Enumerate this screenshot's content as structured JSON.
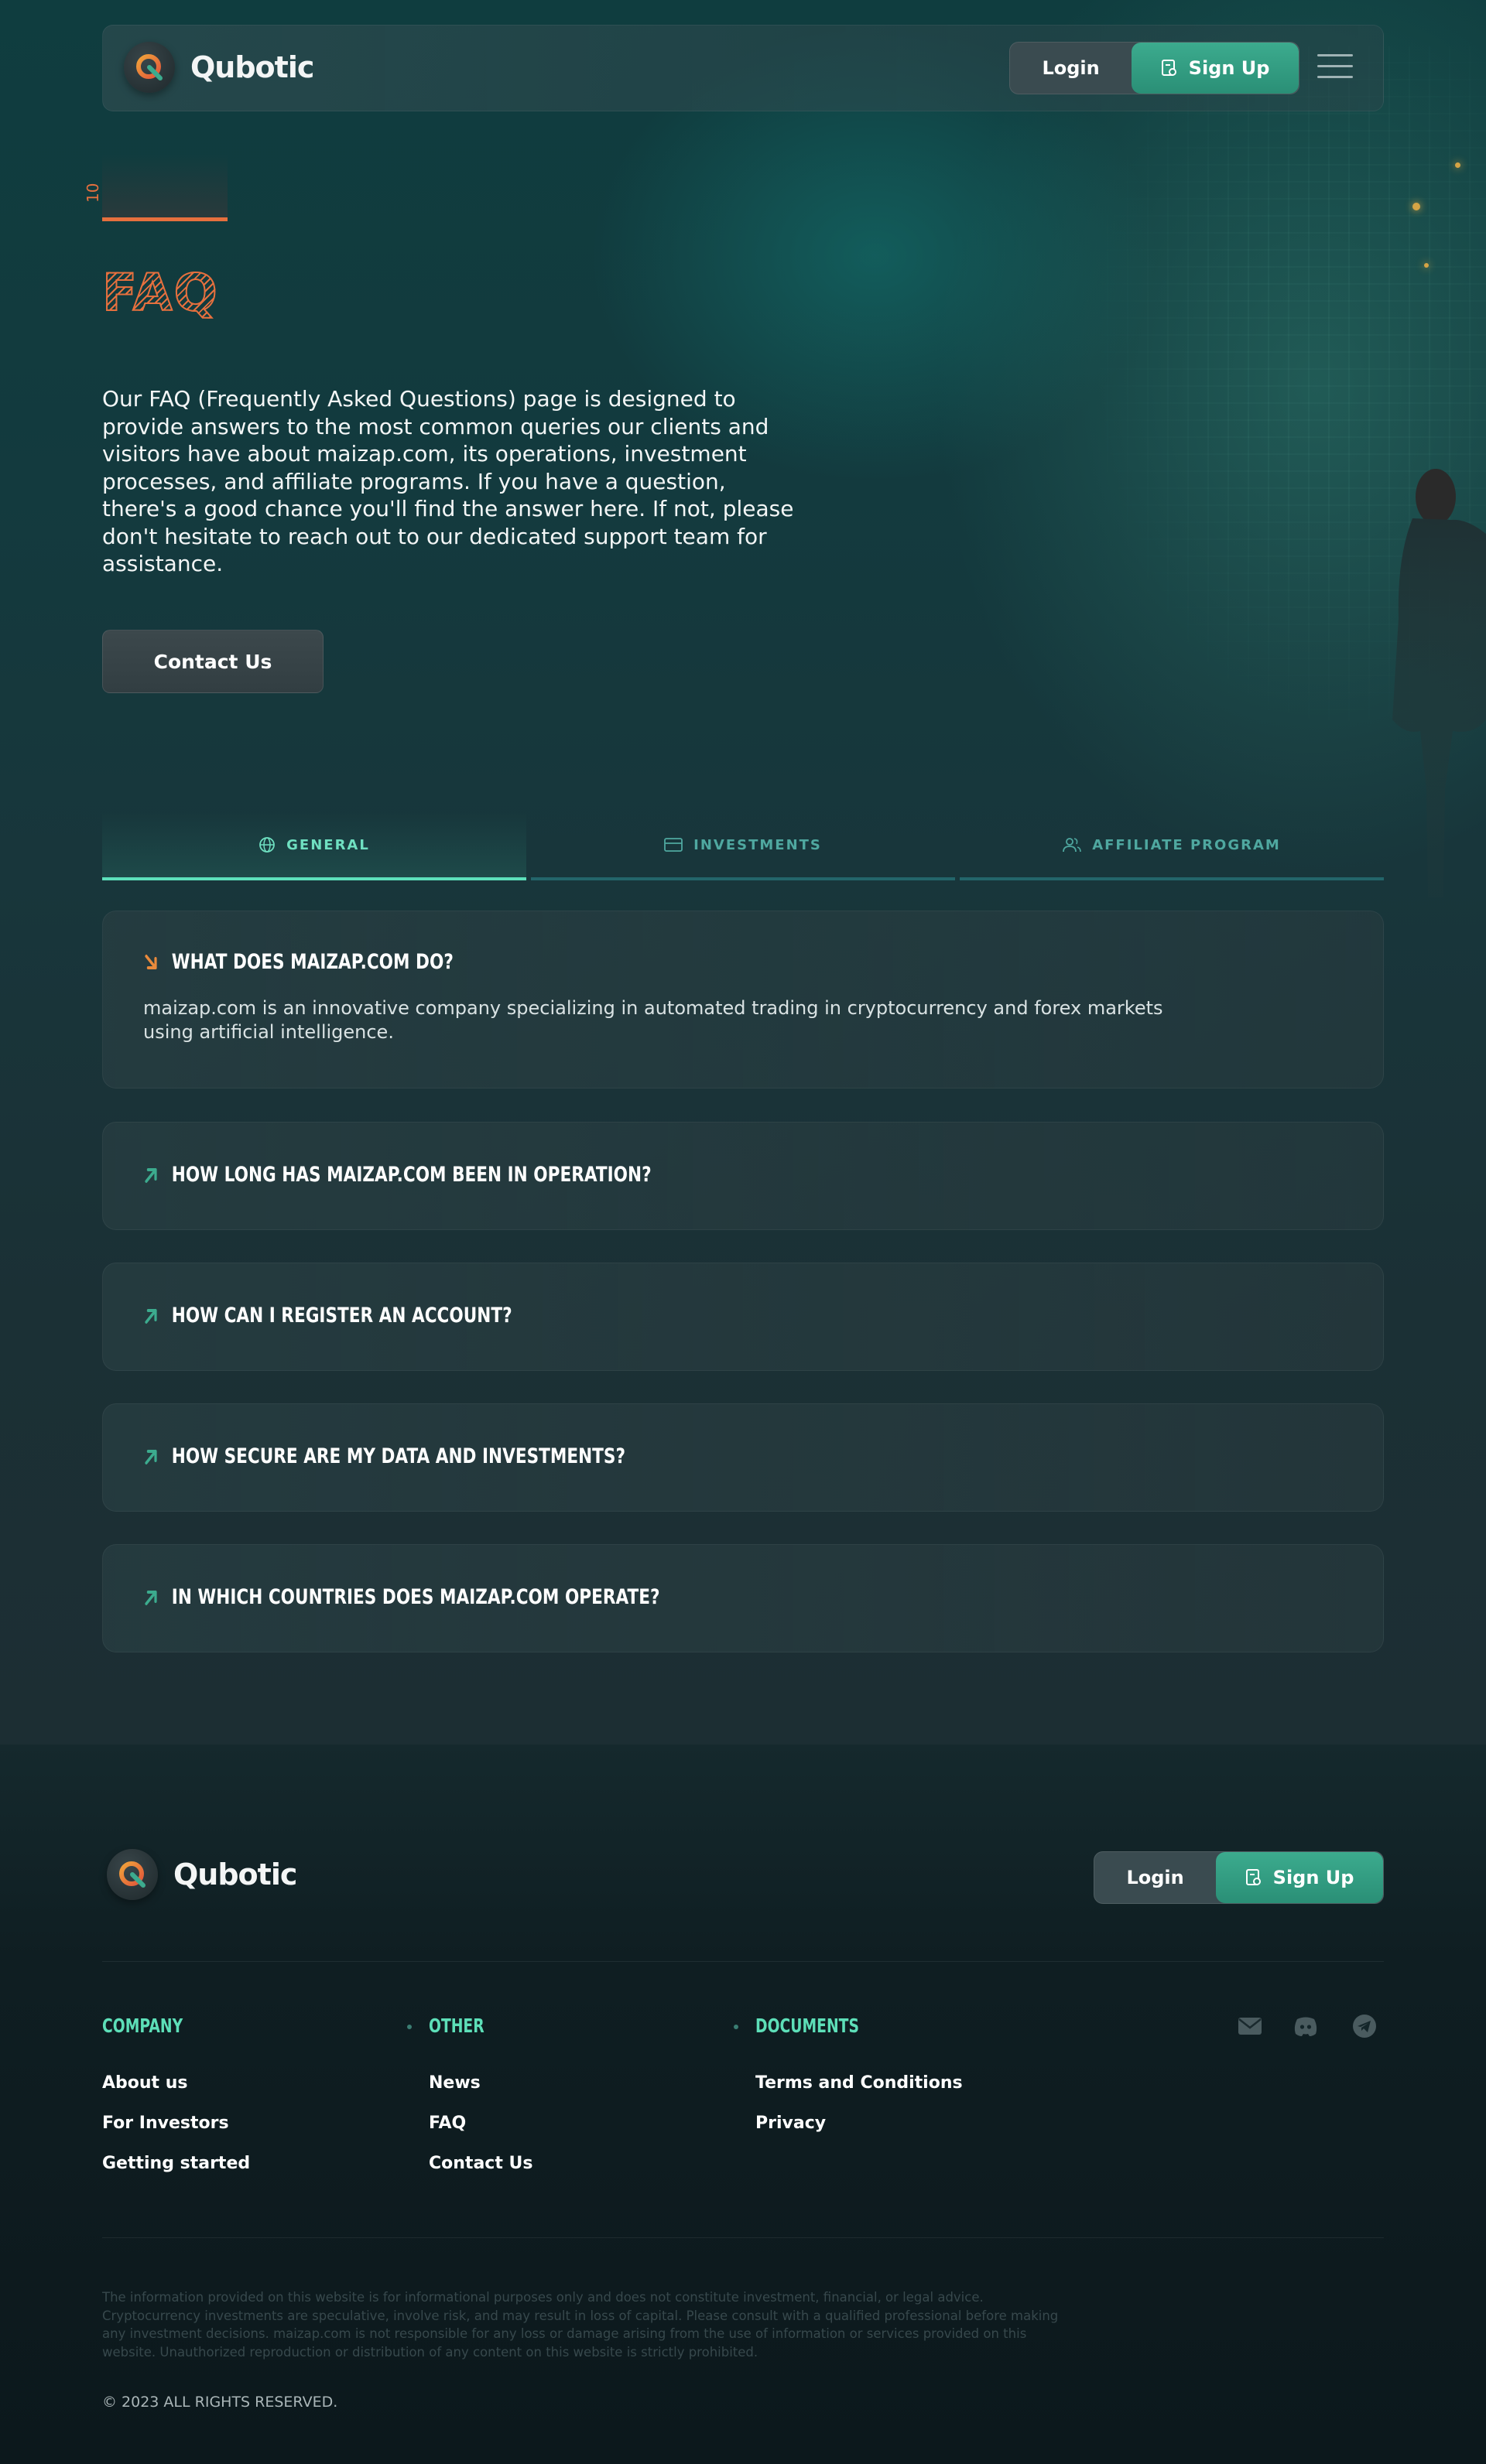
{
  "brand": {
    "name": "Qubotic"
  },
  "header": {
    "login_label": "Login",
    "signup_label": "Sign Up"
  },
  "hero": {
    "marker_digit": "10",
    "title": "FAQ",
    "intro": "Our FAQ (Frequently Asked Questions) page is designed to provide answers to the most common queries our clients and visitors have about maizap.com, its operations, investment processes, and affiliate programs. If you have a question, there's a good chance you'll find the answer here. If not, please don't hesitate to reach out to our dedicated support team for assistance.",
    "contact_label": "Contact Us"
  },
  "tabs": [
    {
      "label": "GENERAL",
      "icon": "globe-icon",
      "active": true
    },
    {
      "label": "INVESTMENTS",
      "icon": "card-icon",
      "active": false
    },
    {
      "label": "AFFILIATE PROGRAM",
      "icon": "users-icon",
      "active": false
    }
  ],
  "faq": [
    {
      "question": "WHAT DOES MAIZAP.COM DO?",
      "answer": "maizap.com is an innovative company specializing in automated trading in cryptocurrency and forex markets using artificial intelligence.",
      "expanded": true
    },
    {
      "question": "HOW LONG HAS MAIZAP.COM BEEN IN OPERATION?",
      "expanded": false
    },
    {
      "question": "HOW CAN I REGISTER AN ACCOUNT?",
      "expanded": false
    },
    {
      "question": "HOW SECURE ARE MY DATA AND INVESTMENTS?",
      "expanded": false
    },
    {
      "question": "IN WHICH COUNTRIES DOES MAIZAP.COM OPERATE?",
      "expanded": false
    }
  ],
  "footer": {
    "login_label": "Login",
    "signup_label": "Sign Up",
    "columns": [
      {
        "heading": "COMPANY",
        "links": [
          "About us",
          "For Investors",
          "Getting started"
        ]
      },
      {
        "heading": "OTHER",
        "links": [
          "News",
          "FAQ",
          "Contact Us"
        ]
      },
      {
        "heading": "DOCUMENTS",
        "links": [
          "Terms and Conditions",
          "Privacy"
        ]
      }
    ],
    "social": [
      "mail-icon",
      "discord-icon",
      "telegram-icon"
    ],
    "disclaimer": "The information provided on this website is for informational purposes only and does not constitute investment, financial, or legal advice. Cryptocurrency investments are speculative, involve risk, and may result in loss of capital. Please consult with a qualified professional before making any investment decisions. maizap.com is not responsible for any loss or damage arising from the use of information or services provided on this website. Unauthorized reproduction or distribution of any content on this website is strictly prohibited.",
    "copyright": "© 2023 ALL RIGHTS RESERVED."
  },
  "colors": {
    "accent_orange": "#e6703e",
    "accent_green": "#3cab8e",
    "tab_active": "#5de0bb",
    "heading_green": "#5ddfb8"
  }
}
